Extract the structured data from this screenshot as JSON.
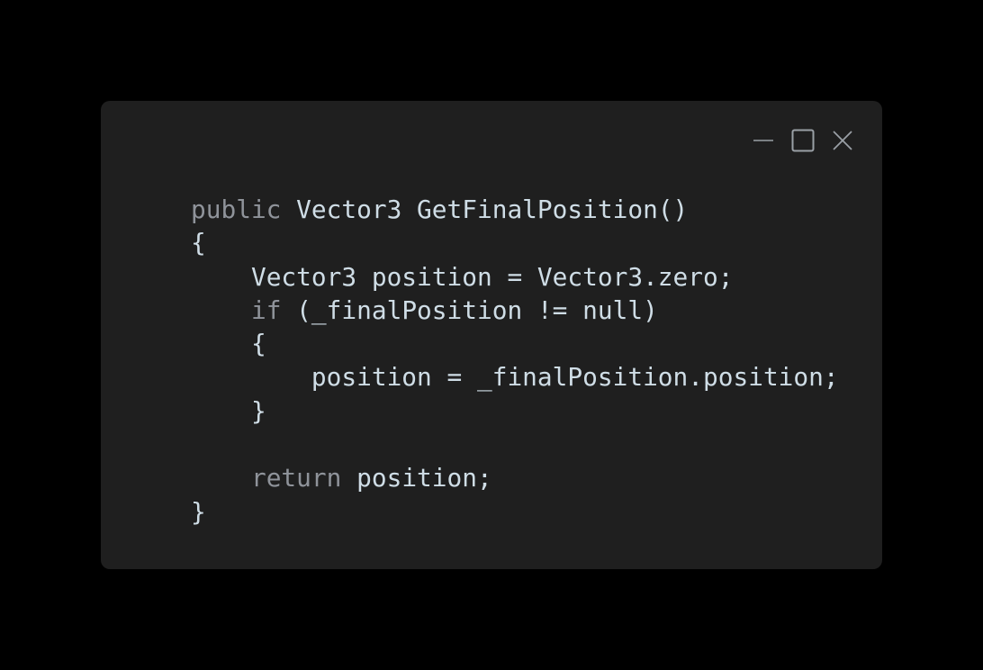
{
  "window": {
    "controls": {
      "minimize_icon": "minimize-icon",
      "maximize_icon": "maximize-icon",
      "close_icon": "close-icon",
      "color": "#9aa0a6"
    },
    "background": "#1f1f1f"
  },
  "code": {
    "keyword_color": "#8f939a",
    "text_color": "#cfdde6",
    "lines": [
      {
        "indent": "",
        "kw": "public",
        "rest": " Vector3 GetFinalPosition()"
      },
      {
        "indent": "",
        "kw": "",
        "rest": "{"
      },
      {
        "indent": "    ",
        "kw": "",
        "rest": "Vector3 position = Vector3.zero;"
      },
      {
        "indent": "    ",
        "kw": "if",
        "rest": " (_finalPosition != null)"
      },
      {
        "indent": "    ",
        "kw": "",
        "rest": "{"
      },
      {
        "indent": "        ",
        "kw": "",
        "rest": "position = _finalPosition.position;"
      },
      {
        "indent": "    ",
        "kw": "",
        "rest": "}"
      },
      {
        "indent": "",
        "kw": "",
        "rest": ""
      },
      {
        "indent": "    ",
        "kw": "return",
        "rest": " position;"
      },
      {
        "indent": "",
        "kw": "",
        "rest": "}"
      }
    ]
  }
}
